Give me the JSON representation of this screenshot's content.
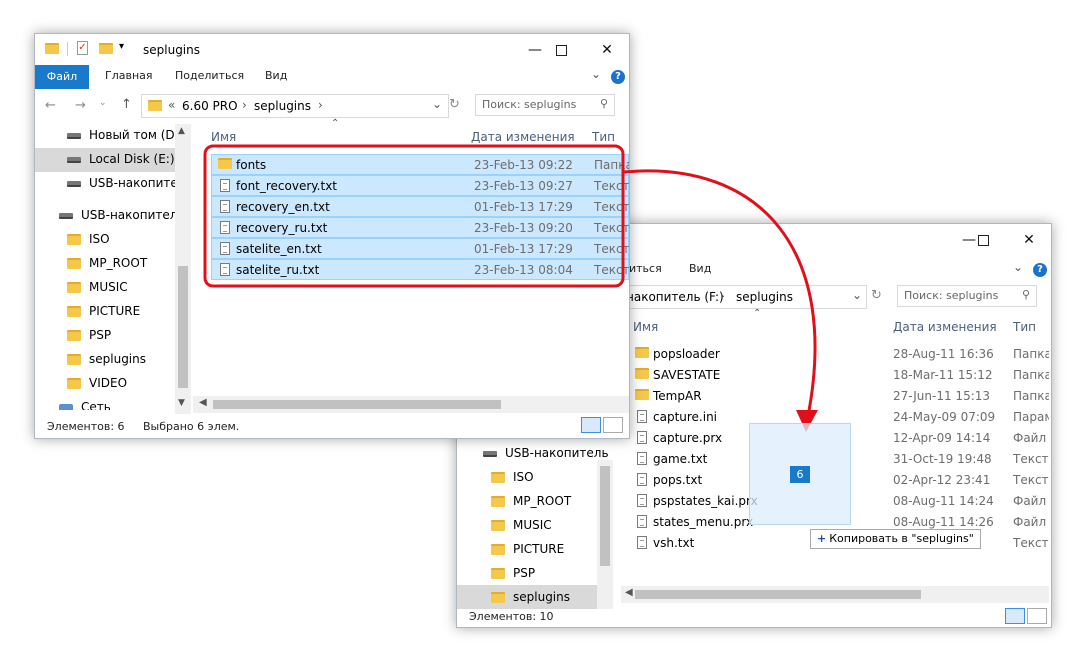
{
  "win1": {
    "title": "seplugins",
    "ribbon": {
      "file": "Файл",
      "tabs": [
        "Главная",
        "Поделиться",
        "Вид"
      ],
      "help": "?"
    },
    "address": {
      "prefix": "«",
      "parts": [
        "6.60 PRO",
        "seplugins"
      ]
    },
    "search_placeholder": "Поиск: seplugins",
    "nav": [
      {
        "label": "Новый том (D:)",
        "icon": "drive-icon"
      },
      {
        "label": "Local Disk (E:)",
        "icon": "drive-icon",
        "selected": true
      },
      {
        "label": "USB-накопитель",
        "icon": "drive-icon"
      },
      {
        "label": "USB-накопитель",
        "icon": "drive-icon"
      },
      {
        "label": "ISO",
        "icon": "folder-icon"
      },
      {
        "label": "MP_ROOT",
        "icon": "folder-icon"
      },
      {
        "label": "MUSIC",
        "icon": "folder-icon"
      },
      {
        "label": "PICTURE",
        "icon": "folder-icon"
      },
      {
        "label": "PSP",
        "icon": "folder-icon"
      },
      {
        "label": "seplugins",
        "icon": "folder-icon"
      },
      {
        "label": "VIDEO",
        "icon": "folder-icon"
      },
      {
        "label": "Сеть",
        "icon": "network-icon"
      }
    ],
    "columns": {
      "name": "Имя",
      "date": "Дата изменения",
      "type": "Тип"
    },
    "files": [
      {
        "name": "fonts",
        "date": "23-Feb-13 09:22",
        "type": "Папка",
        "icon": "folder-icon"
      },
      {
        "name": "font_recovery.txt",
        "date": "23-Feb-13 09:27",
        "type": "Тексто",
        "icon": "text-file-icon"
      },
      {
        "name": "recovery_en.txt",
        "date": "01-Feb-13 17:29",
        "type": "Тексто",
        "icon": "text-file-icon"
      },
      {
        "name": "recovery_ru.txt",
        "date": "23-Feb-13 09:20",
        "type": "Тексто",
        "icon": "text-file-icon"
      },
      {
        "name": "satelite_en.txt",
        "date": "01-Feb-13 17:29",
        "type": "Тексто",
        "icon": "text-file-icon"
      },
      {
        "name": "satelite_ru.txt",
        "date": "23-Feb-13 08:04",
        "type": "Тексто",
        "icon": "text-file-icon"
      }
    ],
    "status": {
      "count": "Элементов: 6",
      "selected": "Выбрано 6 элем."
    }
  },
  "win2": {
    "ribbon": {
      "tabs": [
        "иться",
        "Вид"
      ],
      "help": "?"
    },
    "address": {
      "parts": [
        "накопитель (F:)",
        "seplugins"
      ]
    },
    "search_placeholder": "Поиск: seplugins",
    "nav": [
      {
        "label": "USB-накопитель",
        "icon": "drive-icon"
      },
      {
        "label": "ISO",
        "icon": "folder-icon"
      },
      {
        "label": "MP_ROOT",
        "icon": "folder-icon"
      },
      {
        "label": "MUSIC",
        "icon": "folder-icon"
      },
      {
        "label": "PICTURE",
        "icon": "folder-icon"
      },
      {
        "label": "PSP",
        "icon": "folder-icon"
      },
      {
        "label": "seplugins",
        "icon": "folder-icon",
        "selected": true
      }
    ],
    "columns": {
      "name": "Имя",
      "date": "Дата изменения",
      "type": "Тип"
    },
    "files": [
      {
        "name": "popsloader",
        "date": "28-Aug-11 16:36",
        "type": "Папка",
        "icon": "folder-icon"
      },
      {
        "name": "SAVESTATE",
        "date": "18-Mar-11 15:12",
        "type": "Папка",
        "icon": "folder-icon"
      },
      {
        "name": "TempAR",
        "date": "27-Jun-11 15:13",
        "type": "Папка",
        "icon": "folder-icon"
      },
      {
        "name": "capture.ini",
        "date": "24-May-09 07:09",
        "type": "Парам",
        "icon": "settings-file-icon"
      },
      {
        "name": "capture.prx",
        "date": "12-Apr-09 14:14",
        "type": "Файл \"",
        "icon": "blank-file-icon"
      },
      {
        "name": "game.txt",
        "date": "31-Oct-19 19:48",
        "type": "Тексто",
        "icon": "text-file-icon"
      },
      {
        "name": "pops.txt",
        "date": "02-Apr-12 23:41",
        "type": "Тексто",
        "icon": "text-file-icon"
      },
      {
        "name": "pspstates_kai.prx",
        "date": "08-Aug-11 14:24",
        "type": "Файл \"",
        "icon": "blank-file-icon"
      },
      {
        "name": "states_menu.prx",
        "date": "08-Aug-11 14:26",
        "type": "Файл \"",
        "icon": "blank-file-icon"
      },
      {
        "name": "vsh.txt",
        "date": "",
        "type": "Тексто",
        "icon": "text-file-icon"
      }
    ],
    "status": {
      "count": "Элементов: 10"
    }
  },
  "drag": {
    "count": "6",
    "tooltip": "Копировать в \"seplugins\"",
    "plus": "+"
  },
  "colors": {
    "selection": "#cce8ff",
    "accent": "#1979ca",
    "arrow": "#e0101a"
  }
}
